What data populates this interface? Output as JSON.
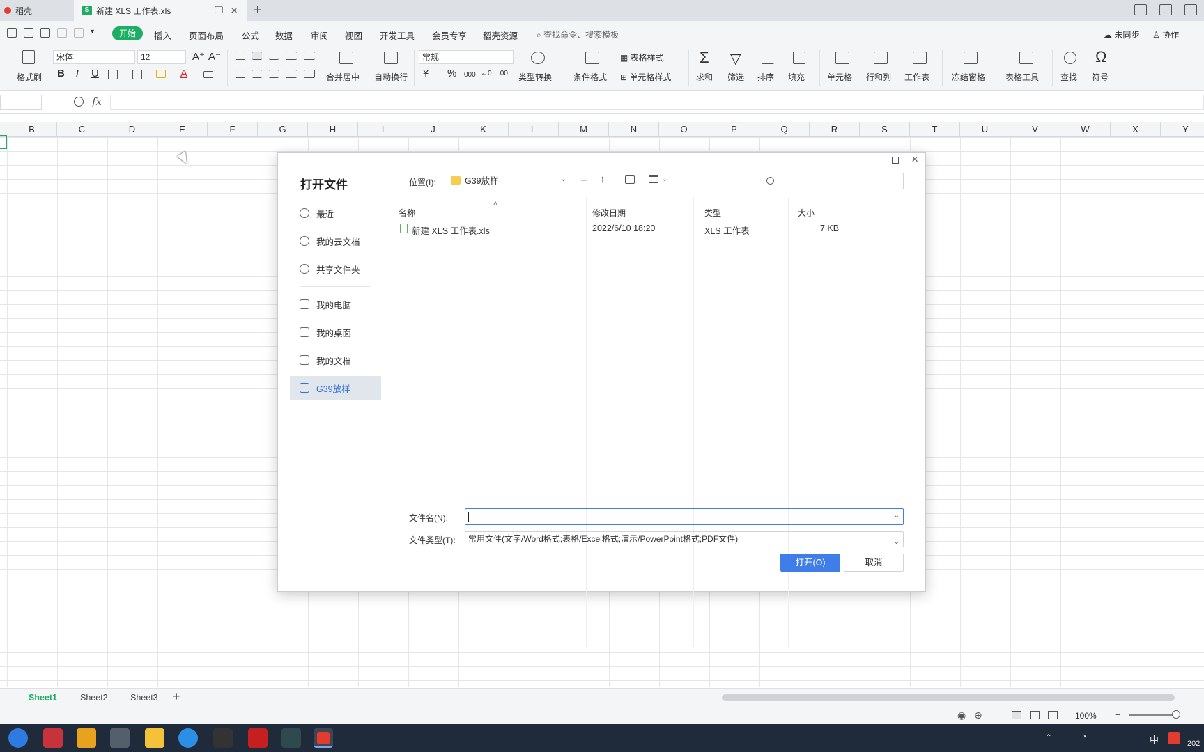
{
  "tabs": {
    "home": "稻壳",
    "doc": "新建 XLS 工作表.xls"
  },
  "menu": {
    "start": "开始",
    "items": [
      "插入",
      "页面布局",
      "公式",
      "数据",
      "审阅",
      "视图",
      "开发工具",
      "会员专享",
      "稻壳资源"
    ],
    "search_placeholder": "查找命令、搜索模板",
    "sync": "未同步",
    "collab": "协作"
  },
  "ribbon": {
    "format_painter": "格式刷",
    "font_name": "宋体",
    "font_size": "12",
    "merge_center": "合并居中",
    "wrap_text": "自动换行",
    "number_format": "常规",
    "type_convert": "类型转换",
    "cond_format": "条件格式",
    "table_style": "表格样式",
    "cell_style": "单元格样式",
    "sum": "求和",
    "filter": "筛选",
    "sort": "排序",
    "fill": "填充",
    "cell": "单元格",
    "row_col": "行和列",
    "worksheet": "工作表",
    "freeze": "冻结窗格",
    "table_tools": "表格工具",
    "find": "查找",
    "symbol": "符号",
    "bold": "B",
    "italic": "I",
    "underline": "U",
    "font_color": "A",
    "currency": "¥",
    "percent": "%",
    "thousands": "000"
  },
  "formula": {
    "fx": "fx"
  },
  "columns": [
    "B",
    "C",
    "D",
    "E",
    "F",
    "G",
    "H",
    "I",
    "J",
    "K",
    "L",
    "M",
    "N",
    "O",
    "P",
    "Q",
    "R",
    "S",
    "T",
    "U",
    "V",
    "W",
    "X",
    "Y"
  ],
  "sheets": [
    "Sheet1",
    "Sheet2",
    "Sheet3"
  ],
  "status": {
    "zoom": "100%"
  },
  "tray": {
    "ime": "中",
    "year": "202"
  },
  "dialog": {
    "title": "打开文件",
    "nav": [
      "最近",
      "我的云文档",
      "共享文件夹",
      "我的电脑",
      "我的桌面",
      "我的文档",
      "G39放样"
    ],
    "location_label": "位置(I):",
    "location": "G39放样",
    "search_placeholder": "",
    "headers": {
      "name": "名称",
      "modified": "修改日期",
      "type": "类型",
      "size": "大小"
    },
    "files": [
      {
        "name": "新建 XLS 工作表.xls",
        "modified": "2022/6/10 18:20",
        "type": "XLS 工作表",
        "size": "7 KB"
      }
    ],
    "filename_label": "文件名(N):",
    "filename_value": "",
    "filetype_label": "文件类型(T):",
    "filetype_value": "常用文件(文字/Word格式;表格/Excel格式;演示/PowerPoint格式;PDF文件)",
    "open_button": "打开(O)",
    "cancel_button": "取消"
  },
  "colors": {
    "accent_green": "#1eae63",
    "dialog_blue": "#3f7ee8"
  }
}
